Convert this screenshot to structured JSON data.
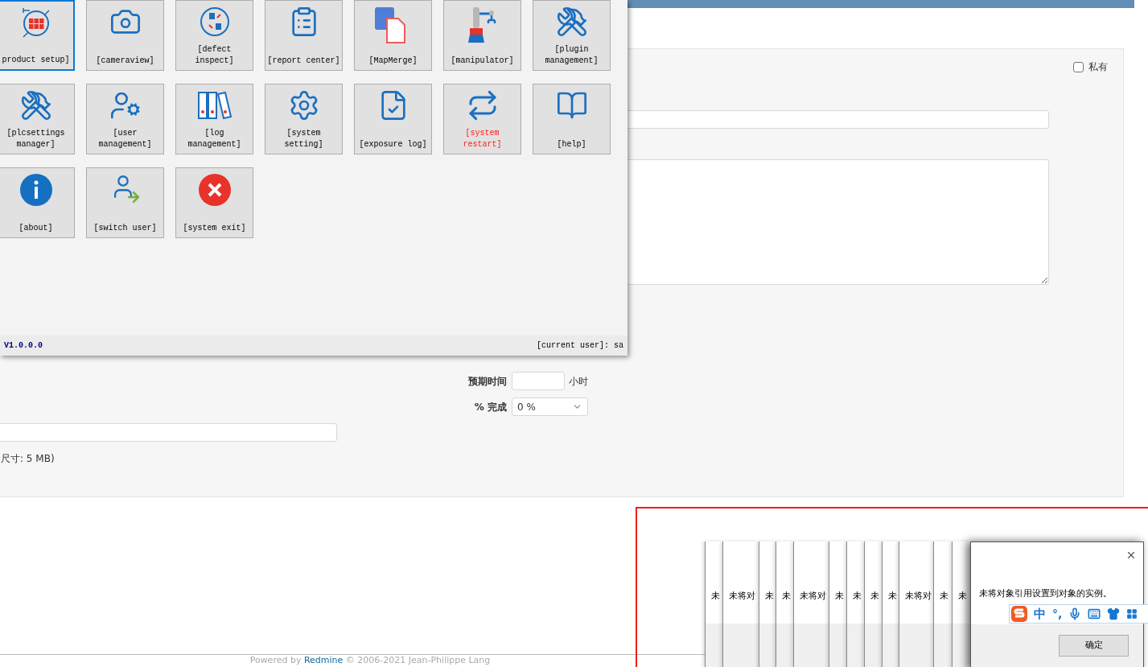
{
  "page": {
    "private_checkbox": {
      "label": "私有",
      "checked": false
    },
    "estimated_time": {
      "label": "预期时间",
      "unit": "小时"
    },
    "done_ratio": {
      "label": "% 完成",
      "value": "0 %"
    },
    "attachment_hint": "尺寸: 5 MB)",
    "footer": {
      "prefix": "Powered by",
      "link": "Redmine",
      "suffix": "© 2006-2021 Jean-Philippe Lang"
    }
  },
  "menu_window": {
    "tiles": [
      {
        "label": "product setup]",
        "selected": true,
        "warning": false
      },
      {
        "label": "[cameraview]",
        "selected": false,
        "warning": false
      },
      {
        "label": "[defect inspect]",
        "selected": false,
        "warning": false
      },
      {
        "label": "[report center]",
        "selected": false,
        "warning": false
      },
      {
        "label": "[MapMerge]",
        "selected": false,
        "warning": false
      },
      {
        "label": "[manipulator]",
        "selected": false,
        "warning": false
      },
      {
        "label": "[plugin management]",
        "selected": false,
        "warning": false
      },
      {
        "label": "[plcsettings manager]",
        "selected": false,
        "warning": false
      },
      {
        "label": "[user management]",
        "selected": false,
        "warning": false
      },
      {
        "label": "[log management]",
        "selected": false,
        "warning": false
      },
      {
        "label": "[system setting]",
        "selected": false,
        "warning": false
      },
      {
        "label": "[exposure log]",
        "selected": false,
        "warning": false
      },
      {
        "label": "[system restart]",
        "selected": false,
        "warning": true
      },
      {
        "label": "[help]",
        "selected": false,
        "warning": false
      },
      {
        "label": "[about]",
        "selected": false,
        "warning": false
      },
      {
        "label": "[switch user]",
        "selected": false,
        "warning": false
      },
      {
        "label": "[system exit]",
        "selected": false,
        "warning": false
      }
    ],
    "version": "V1.0.0.0",
    "current_user": "[current user]: sa"
  },
  "error_dialogs": {
    "stacked_messages": [
      "未",
      "未将对",
      "未",
      "未",
      "未将对",
      "未",
      "未",
      "未",
      "未",
      "未将对",
      "未",
      "未"
    ],
    "message": "未将对象引用设置到对象的实例。",
    "ok_button": "确定"
  },
  "ime_toolbar": {
    "mode": "中",
    "punctuation": "°,"
  }
}
